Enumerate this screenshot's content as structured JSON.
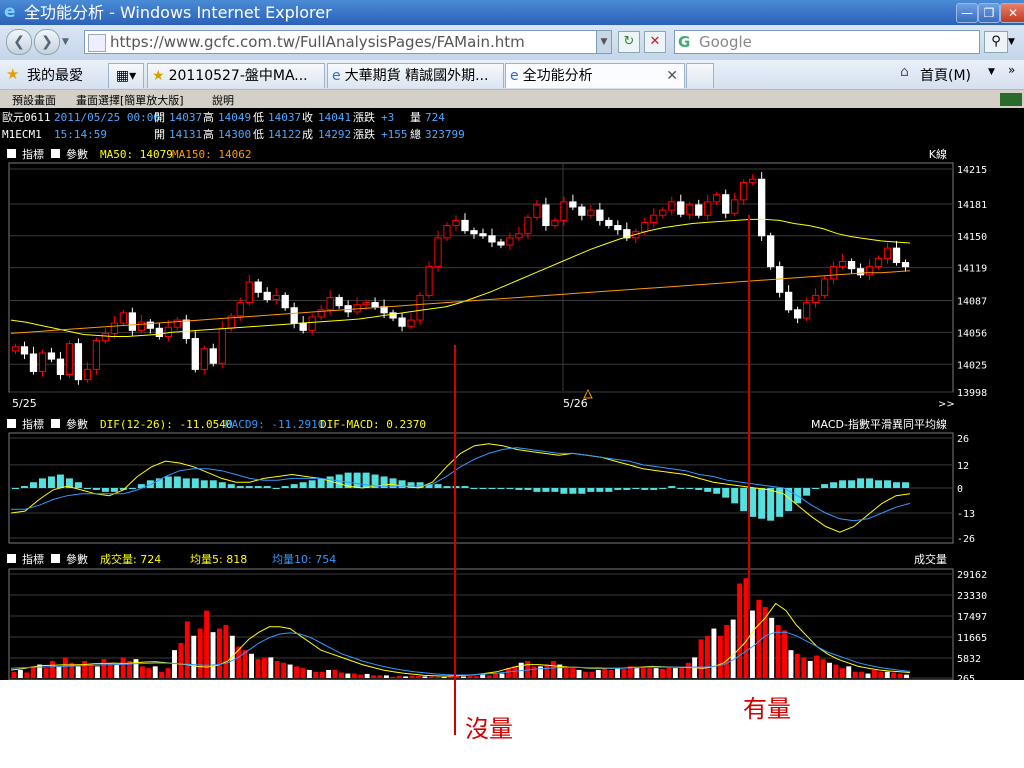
{
  "window": {
    "title": "全功能分析 - Windows Internet Explorer"
  },
  "navbar": {
    "url": "https://www.gcfc.com.tw/FullAnalysisPages/FAMain.htm",
    "search_placeholder": "Google"
  },
  "favbar": {
    "favorites_label": "我的最愛",
    "tabs": [
      "20110527-盤中MA...",
      "大華期貨 精誠國外期...",
      "全功能分析"
    ],
    "home_label": "首頁(M)"
  },
  "app": {
    "menu": [
      "預設畫面",
      "畫面選擇[簡單放大版]",
      "說明"
    ],
    "quote1": {
      "name": "歐元0611",
      "time": "2011/05/25 00:00",
      "open_label": "開",
      "open": "14037",
      "high_label": "高",
      "high": "14049",
      "low_label": "低",
      "low": "14037",
      "close_label": "收",
      "close": "14041",
      "chg_label": "漲跌",
      "chg": "+3",
      "vol_label": "量",
      "vol": "724"
    },
    "quote2": {
      "name": "M1ECM1",
      "time": "15:14:59",
      "open_label": "開",
      "open": "14131",
      "high_label": "高",
      "high": "14300",
      "low_label": "低",
      "low": "14122",
      "deal_label": "成",
      "deal": "14292",
      "chg_label": "漲跌",
      "chg": "+155",
      "total_label": "總",
      "total": "323799"
    },
    "panel_ctrl": {
      "ind": "指標",
      "param": "參數"
    },
    "price_panel": {
      "ma50_text": "MA50: 14079",
      "ma150_text": "MA150: 14062",
      "title": "K線",
      "more": ">>"
    },
    "macd_panel": {
      "dif_text": "DIF(12-26): -11.0540",
      "macd_text": "MACD9: -11.2910",
      "diffm_text": "DIF-MACD: 0.2370",
      "title": "MACD-指數平滑異同平均線"
    },
    "vol_panel": {
      "vol_text": "成交量: 724",
      "v5_text": "均量5: 818",
      "v10_text": "均量10: 754",
      "title": "成交量"
    }
  },
  "annotations": {
    "left": "沒量",
    "right": "有量"
  },
  "colors": {
    "up": "#ff0000",
    "down": "#ffffff",
    "ma50": "#ffff00",
    "ma150": "#ff9900",
    "dif": "#ffff00",
    "macd9": "#3399ff",
    "osc": "#55e0e0",
    "grid": "#3a3a3a",
    "annot": "#d00000"
  },
  "chart_data": [
    {
      "type": "candlestick",
      "title": "K線",
      "x_ticks": [
        "5/25",
        "5/26"
      ],
      "ylim": [
        13998,
        14215
      ],
      "y_ticks": [
        13998,
        14025,
        14056,
        14087,
        14119,
        14150,
        14181,
        14215
      ],
      "close": [
        14042,
        14035,
        14018,
        14036,
        14030,
        14015,
        14045,
        14010,
        14020,
        14048,
        14055,
        14065,
        14075,
        14058,
        14066,
        14060,
        14052,
        14061,
        14068,
        14050,
        14020,
        14040,
        14026,
        14060,
        14072,
        14085,
        14105,
        14095,
        14088,
        14092,
        14080,
        14065,
        14058,
        14071,
        14078,
        14090,
        14082,
        14076,
        14083,
        14085,
        14081,
        14075,
        14070,
        14062,
        14068,
        14092,
        14120,
        14148,
        14160,
        14165,
        14155,
        14152,
        14150,
        14144,
        14141,
        14148,
        14152,
        14168,
        14180,
        14160,
        14165,
        14183,
        14178,
        14170,
        14175,
        14165,
        14160,
        14156,
        14148,
        14154,
        14163,
        14170,
        14175,
        14183,
        14171,
        14180,
        14170,
        14183,
        14190,
        14172,
        14185,
        14202,
        14205,
        14150,
        14120,
        14095,
        14078,
        14070,
        14085,
        14092,
        14108,
        14120,
        14125,
        14118,
        14112,
        14120,
        14128,
        14138,
        14124,
        14120
      ],
      "ma50": [
        14068,
        14066,
        14063,
        14060,
        14057,
        14054,
        14053,
        14052,
        14052,
        14053,
        14054,
        14056,
        14057,
        14058,
        14059,
        14060,
        14061,
        14062,
        14063,
        14064,
        14065,
        14066,
        14067,
        14068,
        14069,
        14071,
        14073,
        14075,
        14077,
        14079,
        14081,
        14085,
        14090,
        14095,
        14101,
        14107,
        14113,
        14119,
        14125,
        14131,
        14137,
        14142,
        14147,
        14151,
        14155,
        14158,
        14160,
        14162,
        14163,
        14164,
        14165,
        14166,
        14166,
        14165,
        14162,
        14160,
        14157,
        14152,
        14149,
        14147,
        14145,
        14144,
        14143
      ],
      "ma150": [
        14055,
        14056,
        14057,
        14058,
        14059,
        14060,
        14061,
        14062,
        14063,
        14064,
        14065,
        14066,
        14067,
        14068,
        14069,
        14070,
        14071,
        14072,
        14073,
        14074,
        14075,
        14076,
        14077,
        14078,
        14079,
        14080,
        14081,
        14082,
        14083,
        14084,
        14085,
        14086,
        14087,
        14088,
        14089,
        14090,
        14091,
        14092,
        14093,
        14094,
        14095,
        14096,
        14097,
        14098,
        14099,
        14100,
        14101,
        14102,
        14103,
        14104,
        14105,
        14106,
        14107,
        14108,
        14109,
        14110,
        14111,
        14112,
        14113,
        14114,
        14114,
        14115,
        14116
      ]
    },
    {
      "type": "macd",
      "title": "MACD-指數平滑異同平均線",
      "ylim": [
        -26,
        26
      ],
      "y_ticks": [
        26,
        12,
        0,
        -13,
        -26
      ],
      "dif": [
        -13,
        -12,
        -6,
        -1,
        1,
        -1,
        -3,
        -4,
        -1,
        6,
        11,
        14,
        13,
        11,
        8,
        5,
        3,
        3,
        5,
        6,
        7,
        6,
        5,
        3,
        1,
        0,
        1,
        2,
        1,
        0,
        3,
        11,
        18,
        22,
        23,
        22,
        20,
        19,
        18,
        17,
        18,
        17,
        16,
        14,
        12,
        10,
        9,
        8,
        7,
        5,
        3,
        2,
        1,
        0,
        -1,
        -3,
        -9,
        -15,
        -20,
        -23,
        -20,
        -14,
        -8,
        -4,
        -3
      ],
      "macd9": [
        -11,
        -11,
        -9,
        -6,
        -4,
        -3,
        -3,
        -3,
        -3,
        -1,
        2,
        6,
        9,
        10,
        10,
        9,
        7,
        5,
        4,
        4,
        5,
        5,
        5,
        4,
        3,
        2,
        1,
        1,
        1,
        1,
        2,
        6,
        11,
        15,
        18,
        20,
        21,
        20,
        19,
        18,
        18,
        17,
        16,
        15,
        14,
        12,
        11,
        10,
        9,
        7,
        6,
        4,
        3,
        2,
        1,
        0,
        -4,
        -9,
        -13,
        -16,
        -17,
        -16,
        -13,
        -10,
        -8
      ],
      "osc": [
        0,
        1,
        3,
        5,
        6,
        7,
        5,
        3,
        0,
        -1,
        -2,
        -2,
        -1,
        0,
        2,
        4,
        5,
        6,
        6,
        5,
        5,
        4,
        4,
        3,
        2,
        1,
        1,
        1,
        1,
        0,
        1,
        2,
        3,
        4,
        5,
        6,
        7,
        8,
        8,
        8,
        7,
        6,
        5,
        4,
        3,
        3,
        2,
        2,
        1,
        1,
        1,
        0,
        0,
        0,
        0,
        0,
        -1,
        -1,
        -2,
        -2,
        -2,
        -3,
        -3,
        -3,
        -2,
        -2,
        -2,
        -1,
        -1,
        0,
        -1,
        -1,
        0,
        1,
        0,
        0,
        -1,
        -2,
        -3,
        -5,
        -8,
        -12,
        -15,
        -16,
        -17,
        -15,
        -12,
        -8,
        -4,
        0,
        2,
        3,
        4,
        4,
        5,
        5,
        4,
        4,
        3,
        3
      ]
    },
    {
      "type": "bar",
      "title": "成交量",
      "ylim": [
        265,
        29162
      ],
      "y_ticks": [
        29162,
        23330,
        17497,
        11665,
        5832,
        265
      ],
      "volume": [
        2000,
        2500,
        1800,
        3500,
        4000,
        3000,
        5000,
        3500,
        6000,
        4500,
        3500,
        5000,
        4000,
        3500,
        5500,
        4500,
        4000,
        6000,
        5000,
        5500,
        3500,
        3000,
        3500,
        2000,
        3000,
        8000,
        10000,
        16000,
        12000,
        14000,
        19000,
        13000,
        14000,
        15000,
        12000,
        9000,
        8000,
        7000,
        5500,
        6000,
        6000,
        5000,
        4500,
        4000,
        3500,
        3000,
        2500,
        2000,
        2000,
        2500,
        2500,
        1800,
        1500,
        1500,
        1200,
        1400,
        1000,
        1000,
        1000,
        600,
        900,
        700,
        900,
        800,
        700,
        700,
        600,
        500,
        800,
        1000,
        700,
        800,
        800,
        1200,
        1000,
        1500,
        1500,
        3000,
        3500,
        4500,
        5000,
        3500,
        3500,
        4000,
        5000,
        4000,
        3000,
        3000,
        2500,
        2000,
        2000,
        2500,
        3000,
        2500,
        3000,
        2800,
        3500,
        3000,
        3500,
        3000,
        3000,
        2800,
        3200,
        3000,
        3200,
        4500,
        6000,
        11000,
        12000,
        14000,
        12000,
        15000,
        16500,
        26500,
        28000,
        19000,
        22000,
        20000,
        17000,
        15000,
        13500,
        8000,
        7000,
        6000,
        5000,
        6500,
        5500,
        4500,
        4000,
        3000,
        3500,
        2000,
        2000,
        1500,
        2500,
        2000,
        2000,
        1800,
        1500,
        1200
      ],
      "v5": [
        2500,
        2800,
        3300,
        3700,
        3800,
        3900,
        3900,
        4000,
        4200,
        4300,
        4400,
        4300,
        4500,
        4700,
        4800,
        4500,
        4200,
        4000,
        3500,
        3300,
        3800,
        5000,
        8000,
        11000,
        13000,
        14500,
        14500,
        14000,
        12000,
        10000,
        8000,
        7000,
        6000,
        5000,
        4000,
        3200,
        2500,
        2000,
        1600,
        1300,
        1000,
        900,
        800,
        900,
        1000,
        1200,
        1600,
        2000,
        2800,
        3500,
        4000,
        4000,
        3800,
        3500,
        3300,
        3200,
        3000,
        3000,
        3000,
        3000,
        3200,
        3300,
        3500,
        3400,
        3300,
        3200,
        3100,
        3000,
        3400,
        4500,
        7000,
        10000,
        14000,
        17000,
        21000,
        19000,
        15000,
        12000,
        9000,
        7000,
        5500,
        4500,
        3500,
        3000,
        2500,
        2200,
        2000,
        1800
      ],
      "v10": [
        3000,
        3100,
        3200,
        3300,
        3400,
        3500,
        3600,
        3700,
        3800,
        3900,
        4000,
        4100,
        4200,
        4300,
        4400,
        4400,
        4300,
        4100,
        3900,
        3800,
        4000,
        4500,
        6000,
        8000,
        10000,
        11500,
        12500,
        12800,
        12500,
        11500,
        10000,
        8500,
        7000,
        6000,
        5000,
        4200,
        3500,
        2900,
        2400,
        2000,
        1700,
        1400,
        1200,
        1100,
        1100,
        1200,
        1400,
        1600,
        1900,
        2200,
        2500,
        2800,
        3000,
        3100,
        3200,
        3200,
        3100,
        3100,
        3000,
        3000,
        3100,
        3200,
        3300,
        3300,
        3300,
        3300,
        3300,
        3300,
        3500,
        4000,
        5500,
        7500,
        9500,
        12000,
        13000,
        13000,
        12000,
        10500,
        9000,
        7500,
        6500,
        5500,
        4500,
        3800,
        3200,
        2800,
        2400,
        2100
      ]
    }
  ]
}
